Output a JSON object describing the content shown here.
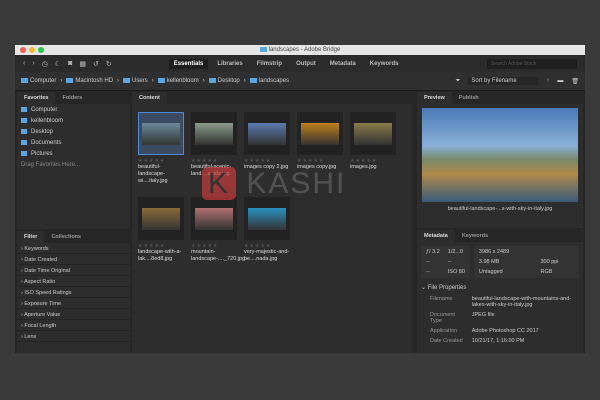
{
  "window": {
    "title": "landscapes - Adobe Bridge"
  },
  "toolbar": {
    "workspaces": [
      "Essentials",
      "Libraries",
      "Filmstrip",
      "Output",
      "Metadata",
      "Keywords"
    ],
    "search_placeholder": "Search Adobe Stock"
  },
  "path": [
    "Computer",
    "Macintosh HD",
    "Users",
    "kellenbloom",
    "Desktop",
    "landscapes"
  ],
  "sort": {
    "label": "Sort by Filename"
  },
  "left": {
    "tabs": [
      "Favorites",
      "Folders"
    ],
    "favorites": [
      "Computer",
      "kellenbloom",
      "Desktop",
      "Documents",
      "Pictures"
    ],
    "drag_hint": "Drag Favorites Here...",
    "filter_tabs": [
      "Filter",
      "Collections"
    ],
    "filters": [
      "Keywords",
      "Date Created",
      "Date Time Original",
      "Aspect Ratio",
      "ISO Speed Ratings",
      "Exposure Time",
      "Aperture Value",
      "Focal Length",
      "Lens"
    ]
  },
  "content": {
    "tab": "Content",
    "items": [
      {
        "name": "beautiful-landscape-wi....italy.jpg",
        "color": "#6a8a9a"
      },
      {
        "name": "beautiful-scenic-land....apids.jpg",
        "color": "#8a9a8a"
      },
      {
        "name": "images copy 2.jpg",
        "color": "#5a7ab0"
      },
      {
        "name": "images copy.jpg",
        "color": "#c0801a"
      },
      {
        "name": "images.jpg",
        "color": "#8a7a4a"
      },
      {
        "name": "landscape-with-a-lak....8ed8.jpg",
        "color": "#8a6a3a"
      },
      {
        "name": "mountain-landscape-...._720.jpg",
        "color": "#b07070"
      },
      {
        "name": "very-majestic-and-be....nada.jpg",
        "color": "#2a90c0"
      }
    ]
  },
  "right": {
    "tabs": [
      "Preview",
      "Publish"
    ],
    "preview_caption": "beautiful-landscape-...s-with-sky-in-italy.jpg",
    "meta_tabs": [
      "Metadata",
      "Keywords"
    ],
    "camera": [
      [
        "ƒ/ 3.2",
        "1/2...0"
      ],
      [
        "--",
        "--"
      ],
      [
        "--",
        "ISO 80"
      ]
    ],
    "file": [
      [
        "3986 x 2489",
        ""
      ],
      [
        "3.98 MB",
        "300 ppi"
      ],
      [
        "Untagged",
        "RGB"
      ]
    ],
    "section": "File Properties",
    "props": [
      [
        "Filename",
        "beautiful-landscape-with-mountains-and-lakes-with-sky-in-italy.jpg"
      ],
      [
        "Document Type",
        "JPEG file"
      ],
      [
        "Application",
        "Adobe Photoshop CC 2017"
      ],
      [
        "Date Created",
        "10/21/17, 1:16:00 PM"
      ]
    ]
  },
  "watermark": "KASHI"
}
